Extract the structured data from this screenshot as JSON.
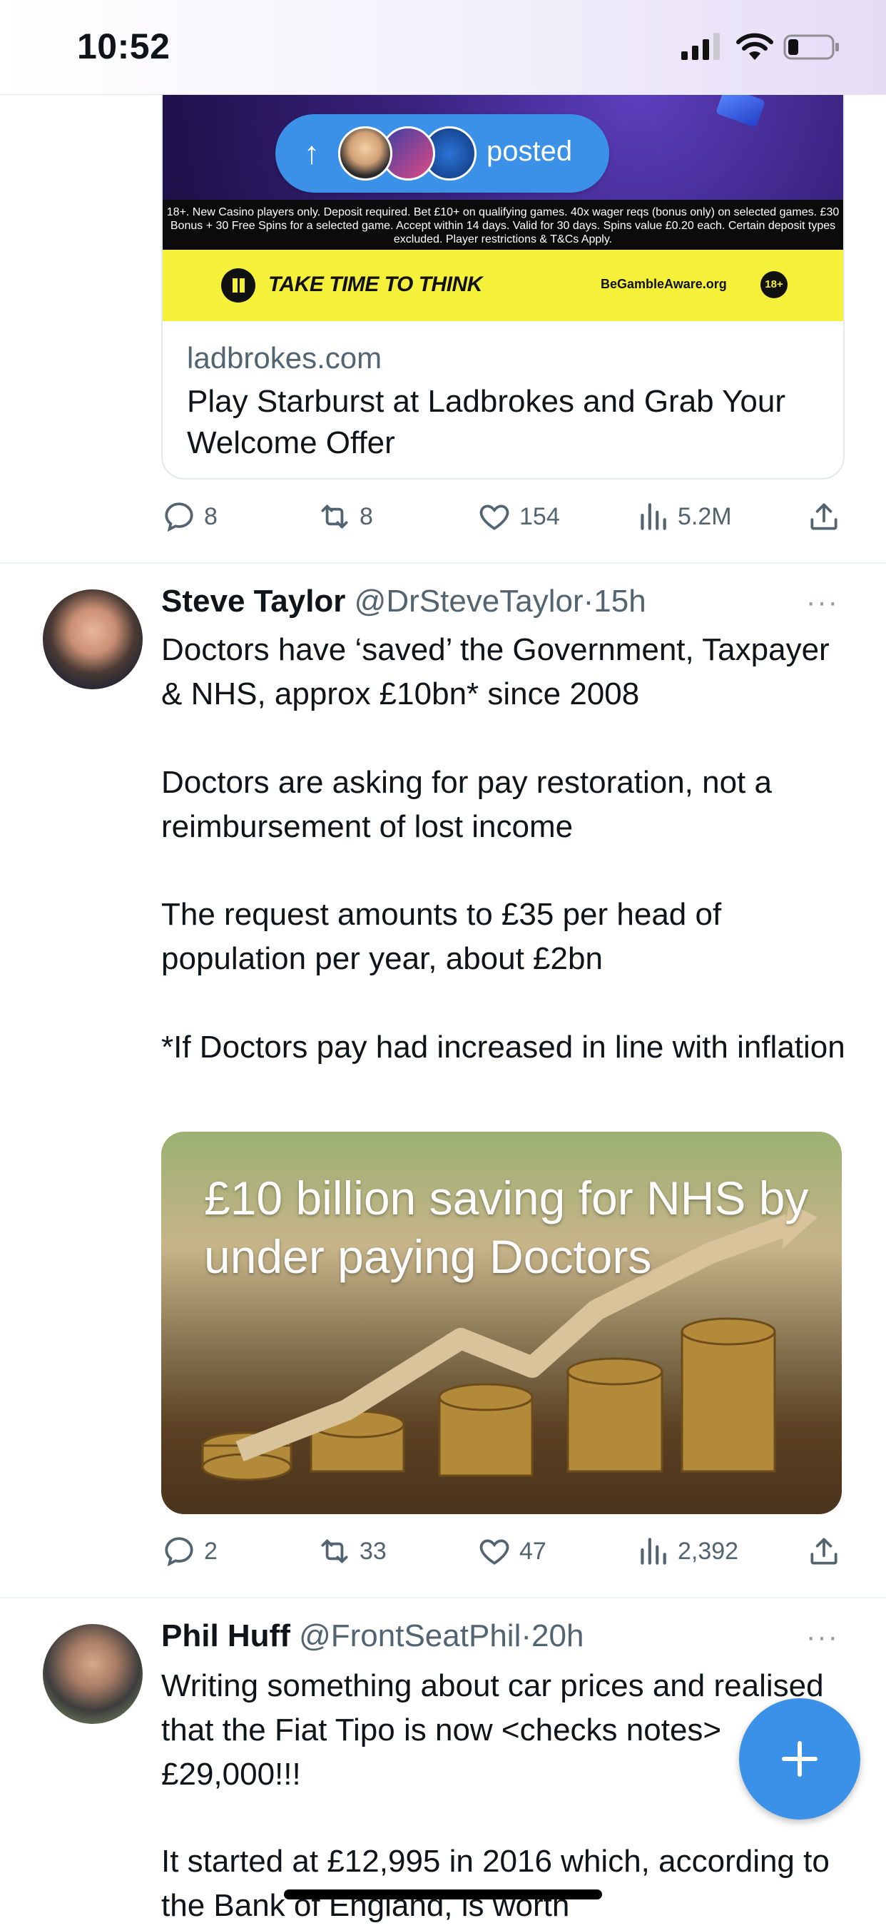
{
  "status_bar": {
    "time": "10:52"
  },
  "ad": {
    "posted_label": "posted",
    "terms": "18+. New Casino players only. Deposit required. Bet £10+ on qualifying games. 40x wager reqs (bonus only) on selected games. £30 Bonus + 30 Free Spins for a selected game. Accept within 14 days. Valid for 30 days. Spins value £0.20 each. Certain deposit types excluded. Player restrictions & T&Cs Apply.",
    "take_time": "TAKE TIME TO THINK",
    "begambleaware": "BeGambleAware.org",
    "age": "18+",
    "link_domain": "ladbrokes.com",
    "link_title": "Play Starburst at Ladbrokes and Grab Your Welcome Offer",
    "actions": {
      "replies": "8",
      "reposts": "8",
      "likes": "154",
      "views": "5.2M"
    }
  },
  "tweets": [
    {
      "name": "Steve Taylor",
      "handle": "@DrSteveTaylor",
      "dot": "·",
      "time": "15h",
      "more": "···",
      "paragraphs": [
        "Doctors have ‘saved’ the Government, Taxpayer & NHS, approx £10bn* since 2008",
        "Doctors are asking for pay restoration, not a reimbursement of lost income",
        "The request amounts to £35 per head of population per year, about £2bn",
        "*If Doctors pay had increased in line with inflation"
      ],
      "image_text": "£10 billion saving for NHS by under paying Doctors",
      "actions": {
        "replies": "2",
        "reposts": "33",
        "likes": "47",
        "views": "2,392"
      }
    },
    {
      "name": "Phil Huff",
      "handle": "@FrontSeatPhil",
      "dot": "·",
      "time": "20h",
      "more": "···",
      "paragraphs": [
        "Writing something about car prices and realised that the Fiat Tipo is now <checks notes> £29,000!!!",
        "It started at £12,995 in 2016 which, according to the Bank of England, is worth"
      ]
    }
  ]
}
